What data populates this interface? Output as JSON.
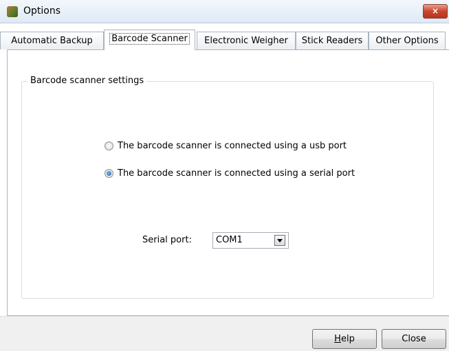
{
  "window": {
    "title": "Options",
    "close_glyph": "×"
  },
  "tabs": [
    {
      "label": "Automatic Backup",
      "active": false
    },
    {
      "label": "Barcode Scanner",
      "active": true
    },
    {
      "label": "Electronic Weigher",
      "active": false
    },
    {
      "label": "Stick Readers",
      "active": false
    },
    {
      "label": "Other Options",
      "active": false
    }
  ],
  "group": {
    "title": "Barcode scanner settings",
    "options": [
      {
        "label": "The barcode scanner is connected using a usb port",
        "checked": false
      },
      {
        "label": "The barcode scanner is connected using a serial port",
        "checked": true
      }
    ],
    "serial_port": {
      "label": "Serial port:",
      "value": "COM1"
    }
  },
  "footer": {
    "help_label": "Help",
    "help_mnemonic": "H",
    "help_rest": "elp",
    "close_label": "Close"
  }
}
